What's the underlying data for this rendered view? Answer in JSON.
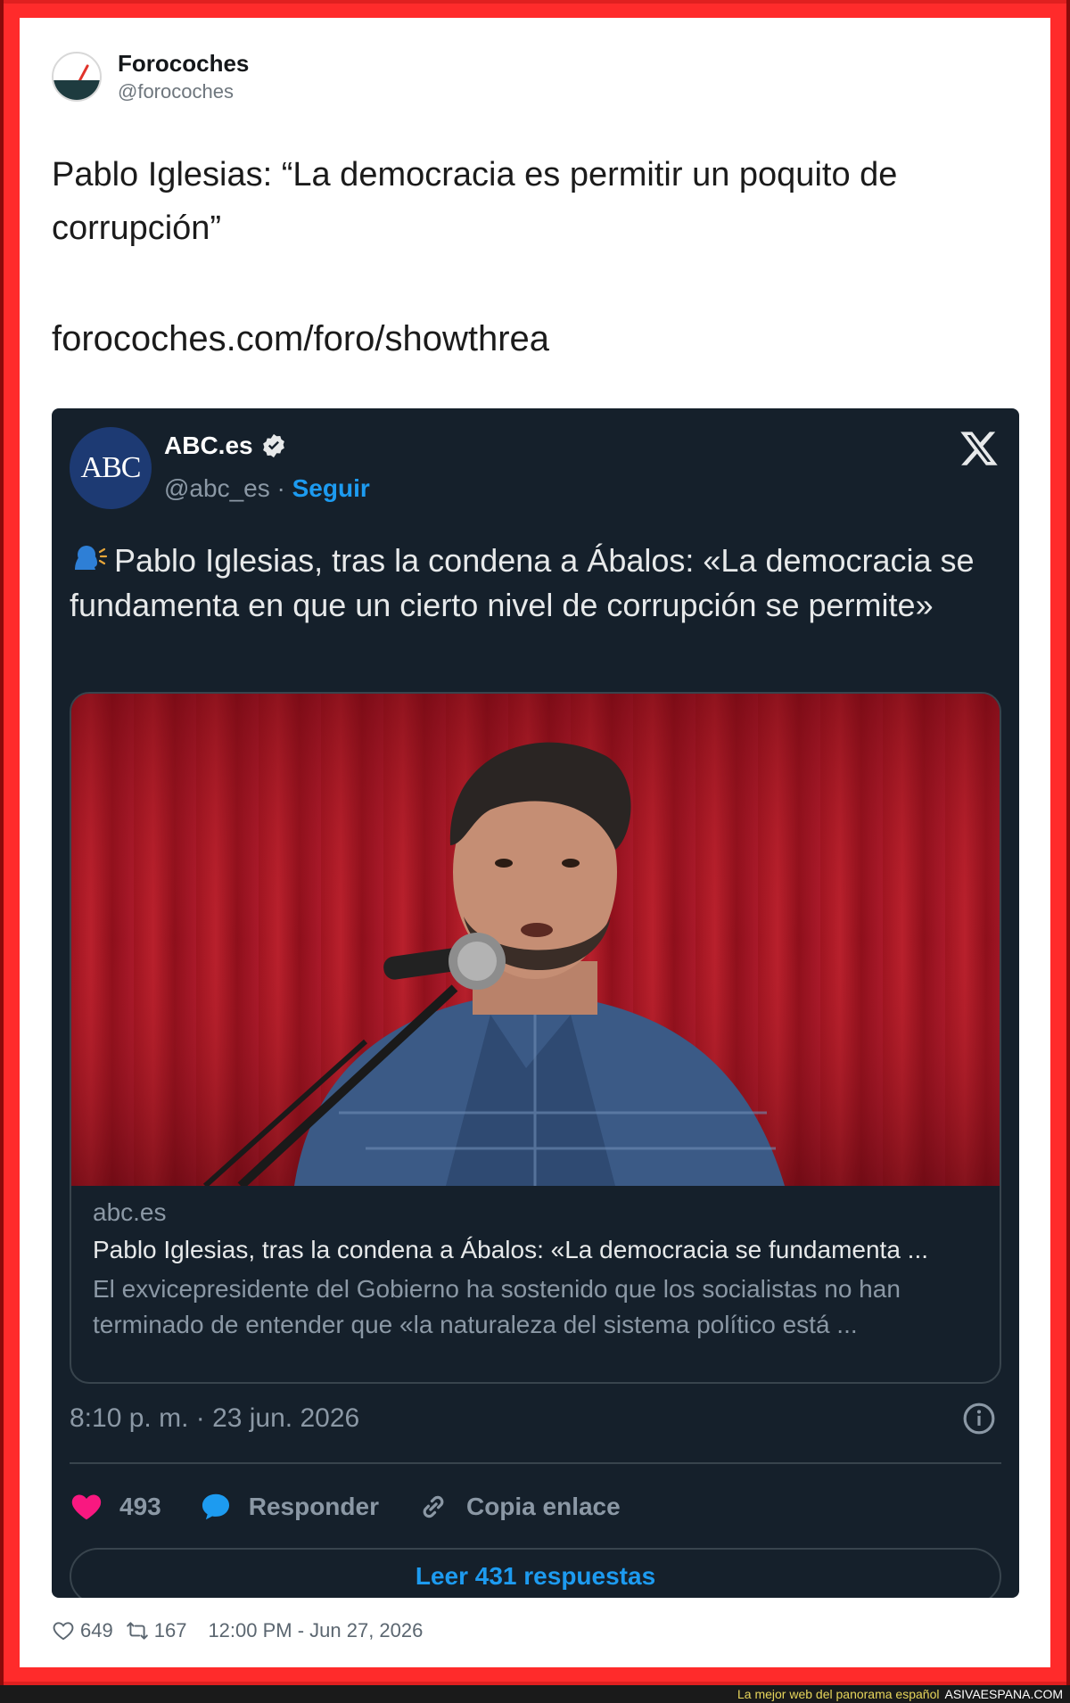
{
  "outer_tweet": {
    "author_name": "Forocoches",
    "author_handle": "@forocoches",
    "text": "Pablo Iglesias: “La democracia es permitir un poquito de corrupción”",
    "link_text": "forocoches.com/foro/showthrea",
    "likes": "649",
    "retweets": "167",
    "timestamp": "12:00 PM - Jun 27, 2026"
  },
  "embedded_tweet": {
    "author_avatar_text": "ABC",
    "author_name": "ABC.es",
    "author_handle": "@abc_es",
    "separator": " · ",
    "follow_label": "Seguir",
    "text": "Pablo Iglesias, tras la condena a Ábalos: «La democracia se fundamenta en que un cierto nivel de corrupción se permite»",
    "card": {
      "domain": "abc.es",
      "title": "Pablo Iglesias, tras la condena a Ábalos: «La democracia se fundamenta ...",
      "description": "El exvicepresidente del Gobierno ha sostenido que los socialistas no han terminado de entender que «la naturaleza del sistema político está ..."
    },
    "timestamp": "8:10 p. m. · 23 jun. 2026",
    "likes": "493",
    "reply_label": "Responder",
    "copy_link_label": "Copia enlace",
    "read_replies_label": "Leer 431 respuestas"
  },
  "watermark": {
    "slogan": "La mejor web del panorama español",
    "site": "ASIVAESPANA.COM"
  },
  "colors": {
    "frame_red": "#ff2b2b",
    "embed_bg": "#15202b",
    "twitter_blue": "#1d9bf0",
    "like_pink": "#f91880"
  }
}
